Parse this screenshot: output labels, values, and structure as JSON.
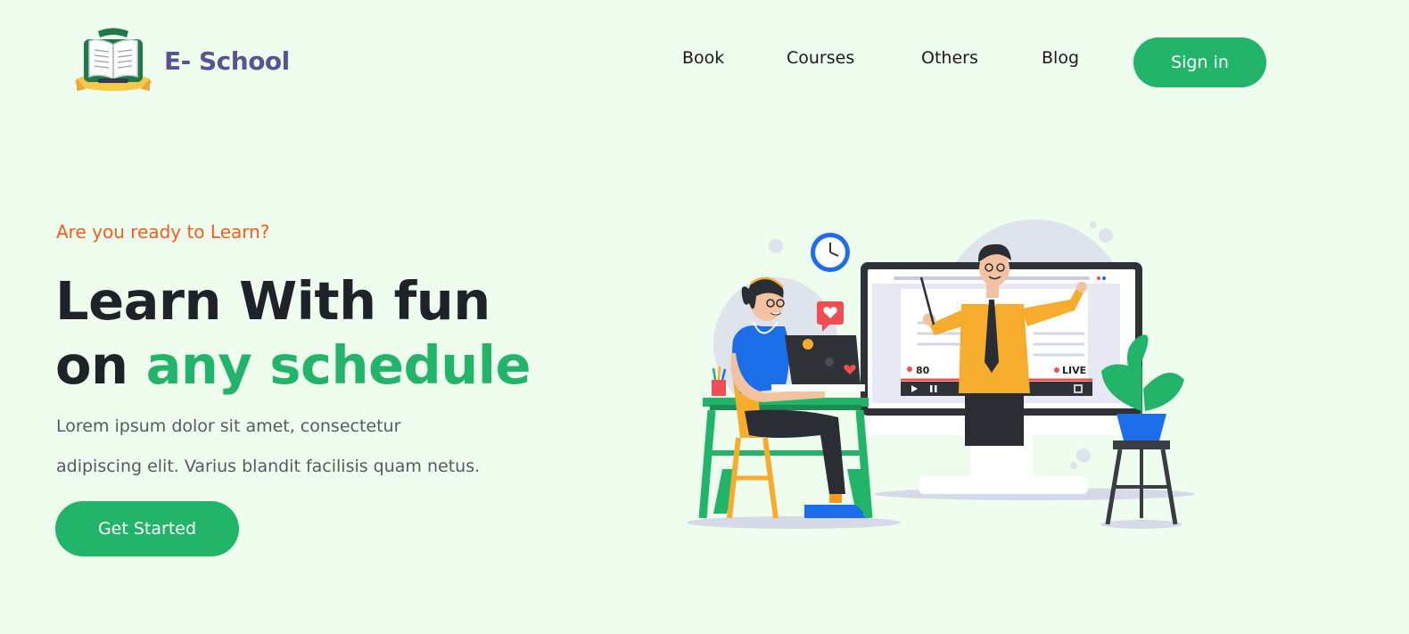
{
  "brand": {
    "name": "E- School",
    "logo_icon": "open-book-icon",
    "color": "#5a5391"
  },
  "nav": {
    "items": [
      {
        "label": "Book"
      },
      {
        "label": "Courses"
      },
      {
        "label": "Others"
      },
      {
        "label": "Blog"
      }
    ],
    "signin_label": "Sign in"
  },
  "hero": {
    "kicker": "Are you ready to Learn?",
    "headline_line1": "Learn With fun",
    "headline_on": "on ",
    "headline_accent": "any schedule",
    "description_line1": "Lorem ipsum dolor sit amet, consectetur",
    "description_line2": "adipiscing elit. Varius blandit facilisis quam netus.",
    "cta_label": "Get Started"
  },
  "illustration": {
    "viewer_count": "80",
    "live_label": "LIVE"
  },
  "colors": {
    "background": "#effdee",
    "accent": "#22b468",
    "kicker": "#f25d1f",
    "heading": "#1f2329"
  }
}
